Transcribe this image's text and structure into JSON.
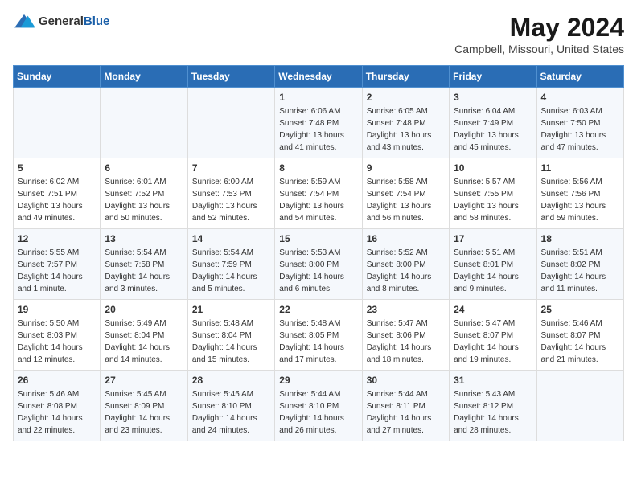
{
  "logo": {
    "general": "General",
    "blue": "Blue"
  },
  "title": "May 2024",
  "subtitle": "Campbell, Missouri, United States",
  "days_of_week": [
    "Sunday",
    "Monday",
    "Tuesday",
    "Wednesday",
    "Thursday",
    "Friday",
    "Saturday"
  ],
  "weeks": [
    [
      {
        "day": "",
        "lines": []
      },
      {
        "day": "",
        "lines": []
      },
      {
        "day": "",
        "lines": []
      },
      {
        "day": "1",
        "lines": [
          "Sunrise: 6:06 AM",
          "Sunset: 7:48 PM",
          "Daylight: 13 hours",
          "and 41 minutes."
        ]
      },
      {
        "day": "2",
        "lines": [
          "Sunrise: 6:05 AM",
          "Sunset: 7:48 PM",
          "Daylight: 13 hours",
          "and 43 minutes."
        ]
      },
      {
        "day": "3",
        "lines": [
          "Sunrise: 6:04 AM",
          "Sunset: 7:49 PM",
          "Daylight: 13 hours",
          "and 45 minutes."
        ]
      },
      {
        "day": "4",
        "lines": [
          "Sunrise: 6:03 AM",
          "Sunset: 7:50 PM",
          "Daylight: 13 hours",
          "and 47 minutes."
        ]
      }
    ],
    [
      {
        "day": "5",
        "lines": [
          "Sunrise: 6:02 AM",
          "Sunset: 7:51 PM",
          "Daylight: 13 hours",
          "and 49 minutes."
        ]
      },
      {
        "day": "6",
        "lines": [
          "Sunrise: 6:01 AM",
          "Sunset: 7:52 PM",
          "Daylight: 13 hours",
          "and 50 minutes."
        ]
      },
      {
        "day": "7",
        "lines": [
          "Sunrise: 6:00 AM",
          "Sunset: 7:53 PM",
          "Daylight: 13 hours",
          "and 52 minutes."
        ]
      },
      {
        "day": "8",
        "lines": [
          "Sunrise: 5:59 AM",
          "Sunset: 7:54 PM",
          "Daylight: 13 hours",
          "and 54 minutes."
        ]
      },
      {
        "day": "9",
        "lines": [
          "Sunrise: 5:58 AM",
          "Sunset: 7:54 PM",
          "Daylight: 13 hours",
          "and 56 minutes."
        ]
      },
      {
        "day": "10",
        "lines": [
          "Sunrise: 5:57 AM",
          "Sunset: 7:55 PM",
          "Daylight: 13 hours",
          "and 58 minutes."
        ]
      },
      {
        "day": "11",
        "lines": [
          "Sunrise: 5:56 AM",
          "Sunset: 7:56 PM",
          "Daylight: 13 hours",
          "and 59 minutes."
        ]
      }
    ],
    [
      {
        "day": "12",
        "lines": [
          "Sunrise: 5:55 AM",
          "Sunset: 7:57 PM",
          "Daylight: 14 hours",
          "and 1 minute."
        ]
      },
      {
        "day": "13",
        "lines": [
          "Sunrise: 5:54 AM",
          "Sunset: 7:58 PM",
          "Daylight: 14 hours",
          "and 3 minutes."
        ]
      },
      {
        "day": "14",
        "lines": [
          "Sunrise: 5:54 AM",
          "Sunset: 7:59 PM",
          "Daylight: 14 hours",
          "and 5 minutes."
        ]
      },
      {
        "day": "15",
        "lines": [
          "Sunrise: 5:53 AM",
          "Sunset: 8:00 PM",
          "Daylight: 14 hours",
          "and 6 minutes."
        ]
      },
      {
        "day": "16",
        "lines": [
          "Sunrise: 5:52 AM",
          "Sunset: 8:00 PM",
          "Daylight: 14 hours",
          "and 8 minutes."
        ]
      },
      {
        "day": "17",
        "lines": [
          "Sunrise: 5:51 AM",
          "Sunset: 8:01 PM",
          "Daylight: 14 hours",
          "and 9 minutes."
        ]
      },
      {
        "day": "18",
        "lines": [
          "Sunrise: 5:51 AM",
          "Sunset: 8:02 PM",
          "Daylight: 14 hours",
          "and 11 minutes."
        ]
      }
    ],
    [
      {
        "day": "19",
        "lines": [
          "Sunrise: 5:50 AM",
          "Sunset: 8:03 PM",
          "Daylight: 14 hours",
          "and 12 minutes."
        ]
      },
      {
        "day": "20",
        "lines": [
          "Sunrise: 5:49 AM",
          "Sunset: 8:04 PM",
          "Daylight: 14 hours",
          "and 14 minutes."
        ]
      },
      {
        "day": "21",
        "lines": [
          "Sunrise: 5:48 AM",
          "Sunset: 8:04 PM",
          "Daylight: 14 hours",
          "and 15 minutes."
        ]
      },
      {
        "day": "22",
        "lines": [
          "Sunrise: 5:48 AM",
          "Sunset: 8:05 PM",
          "Daylight: 14 hours",
          "and 17 minutes."
        ]
      },
      {
        "day": "23",
        "lines": [
          "Sunrise: 5:47 AM",
          "Sunset: 8:06 PM",
          "Daylight: 14 hours",
          "and 18 minutes."
        ]
      },
      {
        "day": "24",
        "lines": [
          "Sunrise: 5:47 AM",
          "Sunset: 8:07 PM",
          "Daylight: 14 hours",
          "and 19 minutes."
        ]
      },
      {
        "day": "25",
        "lines": [
          "Sunrise: 5:46 AM",
          "Sunset: 8:07 PM",
          "Daylight: 14 hours",
          "and 21 minutes."
        ]
      }
    ],
    [
      {
        "day": "26",
        "lines": [
          "Sunrise: 5:46 AM",
          "Sunset: 8:08 PM",
          "Daylight: 14 hours",
          "and 22 minutes."
        ]
      },
      {
        "day": "27",
        "lines": [
          "Sunrise: 5:45 AM",
          "Sunset: 8:09 PM",
          "Daylight: 14 hours",
          "and 23 minutes."
        ]
      },
      {
        "day": "28",
        "lines": [
          "Sunrise: 5:45 AM",
          "Sunset: 8:10 PM",
          "Daylight: 14 hours",
          "and 24 minutes."
        ]
      },
      {
        "day": "29",
        "lines": [
          "Sunrise: 5:44 AM",
          "Sunset: 8:10 PM",
          "Daylight: 14 hours",
          "and 26 minutes."
        ]
      },
      {
        "day": "30",
        "lines": [
          "Sunrise: 5:44 AM",
          "Sunset: 8:11 PM",
          "Daylight: 14 hours",
          "and 27 minutes."
        ]
      },
      {
        "day": "31",
        "lines": [
          "Sunrise: 5:43 AM",
          "Sunset: 8:12 PM",
          "Daylight: 14 hours",
          "and 28 minutes."
        ]
      },
      {
        "day": "",
        "lines": []
      }
    ]
  ]
}
